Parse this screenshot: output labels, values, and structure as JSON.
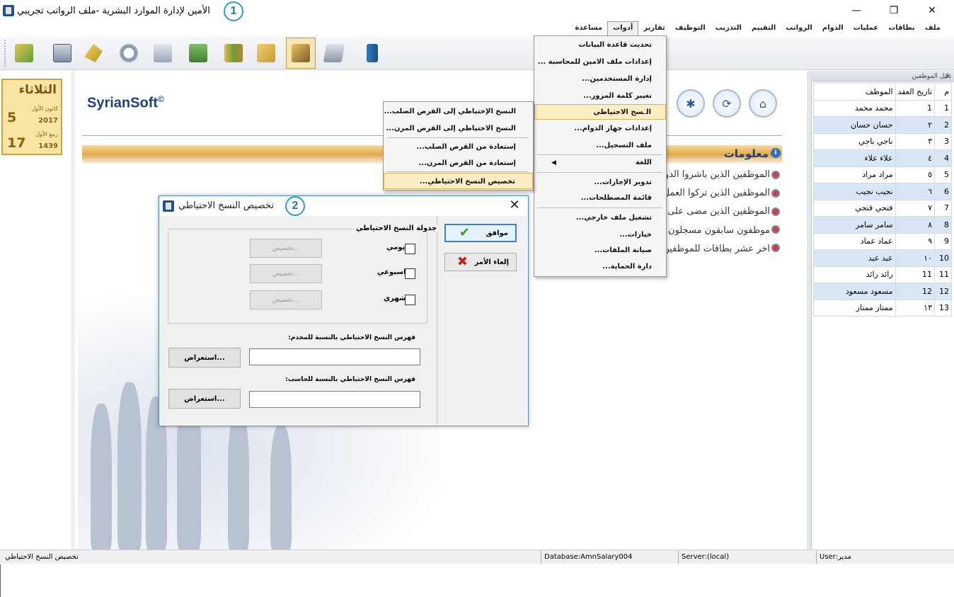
{
  "window": {
    "title": "الأمين لإدارة الموارد البشرية -ملف الرواتب تجريبي",
    "callouts": [
      "1",
      "2"
    ],
    "controls": {
      "minimize": "—",
      "maximize": "❐",
      "close": "✕"
    }
  },
  "menubar": {
    "items": [
      "ملف",
      "بطاقات",
      "عمليات",
      "الدوام",
      "الرواتب",
      "التقييم",
      "التدريب",
      "التوظيف",
      "تقارير",
      "أدوات",
      "مساعدة"
    ],
    "active": "أدوات"
  },
  "toolbar": {
    "buttons": [
      "refresh-folder-icon",
      "employee-card-icon",
      "add-user-icon",
      "clock-icon",
      "attendance-clock-icon",
      "salary-calculator-icon",
      "books-icon",
      "folder-tag-icon",
      "employees-folder-icon",
      "calculator-icon",
      "exit-door-icon"
    ],
    "pressed_index": 8
  },
  "date_panel": {
    "day_name": "الثلاثاء",
    "greg_day": "5",
    "greg_month": "كانون الأول",
    "greg_year": "2017",
    "hijri_day": "17",
    "hijri_month": "ربيع الأول",
    "hijri_year": "1439"
  },
  "home": {
    "brand": "SyrianSoft",
    "brand_mark": "©",
    "section_title": "معلومات",
    "info_lines": [
      "الموظفين الذين باشروا الدوام",
      "الموظفين الذين تركوا العمل",
      "الموظفين الذين مضى على",
      "موظفون سابقون مسجلون",
      "آخر عشر بطاقات للموظفين"
    ],
    "nav_buttons": [
      "gear-icon",
      "refresh-icon",
      "home-icon"
    ]
  },
  "tools_menu": {
    "items": [
      {
        "label": "تحديث قاعدة البيانات"
      },
      {
        "label": "إعدادات ملف الامين للمحاسبة ..."
      },
      {
        "label": "إدارة المستخدمين..."
      },
      {
        "label": "تغيير كلمة المرور..."
      },
      {
        "label": "النسخ الاحتياطي",
        "submenu": true,
        "highlight": true
      },
      {
        "label": "إعدادات جهاز الدوام..."
      },
      {
        "label": "ملف التسجيل..."
      },
      {
        "label": "اللغة",
        "submenu": true
      },
      {
        "label": "تدوير الإجازات..."
      },
      {
        "label": "قائمة المصطلحات..."
      },
      {
        "label": "تشغيل ملف خارجي..."
      },
      {
        "label": "خيارات..."
      },
      {
        "label": "صيانة الملفات..."
      },
      {
        "label": "دارة الحماية..."
      }
    ]
  },
  "backup_menu": {
    "items": [
      "النسخ الإحتياطي إلى القرص الصلب...",
      "النسخ الاحتياطي إلى القرص المرن...",
      "إستعادة من القرص الصلب...",
      "إستعادة من القرص المرن...",
      "تخصيص النسخ الاحتياطي..."
    ]
  },
  "dialog": {
    "title": "تخصيص النسخ الاحتياطي",
    "ok": "موافق",
    "cancel": "إلغاء الأمر",
    "schedule_group": "جدولة النسخ الاحتياطي",
    "daily": "يومي",
    "weekly": "اسبوعي",
    "monthly": "شهري",
    "customize": "تخصيص...",
    "server_path_label": "فهرس النسخ الاحتياطي بالنسبة للمخدم:",
    "server_path_value": "",
    "local_path_label": "فهرس النسخ الاحتياطي بالنسبة للحاسب:",
    "local_path_value": "",
    "browse": "استعراض..."
  },
  "employees_panel": {
    "title": "دليل الموظفين",
    "close": "×",
    "columns": [
      "م",
      "تاريخ العقد",
      "الموظف"
    ],
    "rows": [
      {
        "n": "1",
        "d": "1",
        "name": "محمد محمد"
      },
      {
        "n": "2",
        "d": "٢",
        "name": "حسان حسان"
      },
      {
        "n": "3",
        "d": "٣",
        "name": "ناجي ناجي"
      },
      {
        "n": "4",
        "d": "٤",
        "name": "علاء علاء"
      },
      {
        "n": "5",
        "d": "٥",
        "name": "مراد مراد"
      },
      {
        "n": "6",
        "d": "٦",
        "name": "نجيب نجيب"
      },
      {
        "n": "7",
        "d": "٧",
        "name": "فتحي فتحي"
      },
      {
        "n": "8",
        "d": "٨",
        "name": "سامر سامر"
      },
      {
        "n": "9",
        "d": "٩",
        "name": "عماد عماد"
      },
      {
        "n": "10",
        "d": "١٠",
        "name": "عبد عبد"
      },
      {
        "n": "11",
        "d": "11",
        "name": "رائد رائد"
      },
      {
        "n": "12",
        "d": "12",
        "name": "مسعود مسعود"
      },
      {
        "n": "13",
        "d": "١٣",
        "name": "ممتاز ممتاز"
      }
    ]
  },
  "statusbar": {
    "left": "تخصيص النسخ الاحتياطي",
    "database": "Database:AmnSalary004",
    "server": "Server:(local)",
    "user": "User:مدير"
  },
  "colors": {
    "accent": "#1d3f7a",
    "highlight": "#fbeec3",
    "dialog_border": "#4a90d0"
  }
}
